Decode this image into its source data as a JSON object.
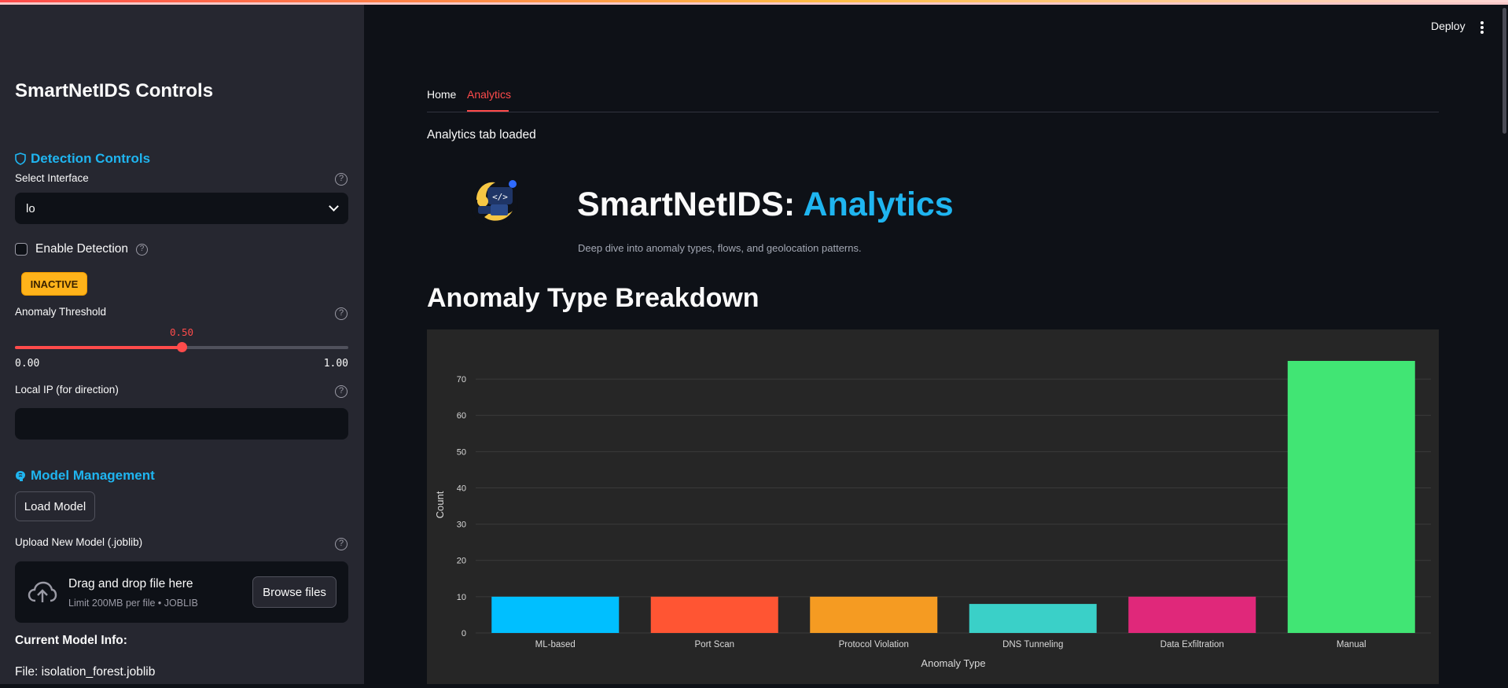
{
  "sidebar": {
    "title": "SmartNetIDS Controls",
    "detection": {
      "heading": "Detection Controls",
      "interface_label": "Select Interface",
      "interface_value": "lo",
      "enable_label": "Enable Detection",
      "status_badge": "INACTIVE",
      "threshold_label": "Anomaly Threshold",
      "threshold_value": "0.50",
      "threshold_fraction": 0.5,
      "threshold_min": "0.00",
      "threshold_max": "1.00",
      "local_ip_label": "Local IP (for direction)",
      "local_ip_value": ""
    },
    "model": {
      "heading": "Model Management",
      "load_button": "Load Model",
      "upload_label": "Upload New Model (.joblib)",
      "dropzone_title": "Drag and drop file here",
      "dropzone_limit": "Limit 200MB per file • JOBLIB",
      "browse_button": "Browse files",
      "current_info_label": "Current Model Info:",
      "file_line": "File: isolation_forest.joblib"
    }
  },
  "header": {
    "deploy_label": "Deploy"
  },
  "tabs": [
    {
      "label": "Home",
      "active": false
    },
    {
      "label": "Analytics",
      "active": true
    }
  ],
  "main": {
    "status_text": "Analytics tab loaded",
    "logo_glyph": "</>",
    "title_prefix": "SmartNetIDS: ",
    "title_accent": "Analytics",
    "subtitle": "Deep dive into anomaly types, flows, and geolocation patterns.",
    "section_heading": "Anomaly Type Breakdown"
  },
  "colors": {
    "accent_blue": "#1fb5f0",
    "accent_red": "#ff4b4b",
    "badge_amber": "#ffb31a"
  },
  "chart_data": {
    "type": "bar",
    "categories": [
      "ML-based",
      "Port Scan",
      "Protocol Violation",
      "DNS Tunneling",
      "Data Exfiltration",
      "Manual"
    ],
    "values": [
      10,
      10,
      10,
      8,
      10,
      75
    ],
    "colors": [
      "#00bfff",
      "#ff5533",
      "#f59b22",
      "#3ad0c8",
      "#e0287a",
      "#41e574"
    ],
    "xlabel": "Anomaly Type",
    "ylabel": "Count",
    "ylim": [
      0,
      75
    ],
    "yticks": [
      0,
      10,
      20,
      30,
      40,
      50,
      60,
      70
    ],
    "grid": true
  }
}
